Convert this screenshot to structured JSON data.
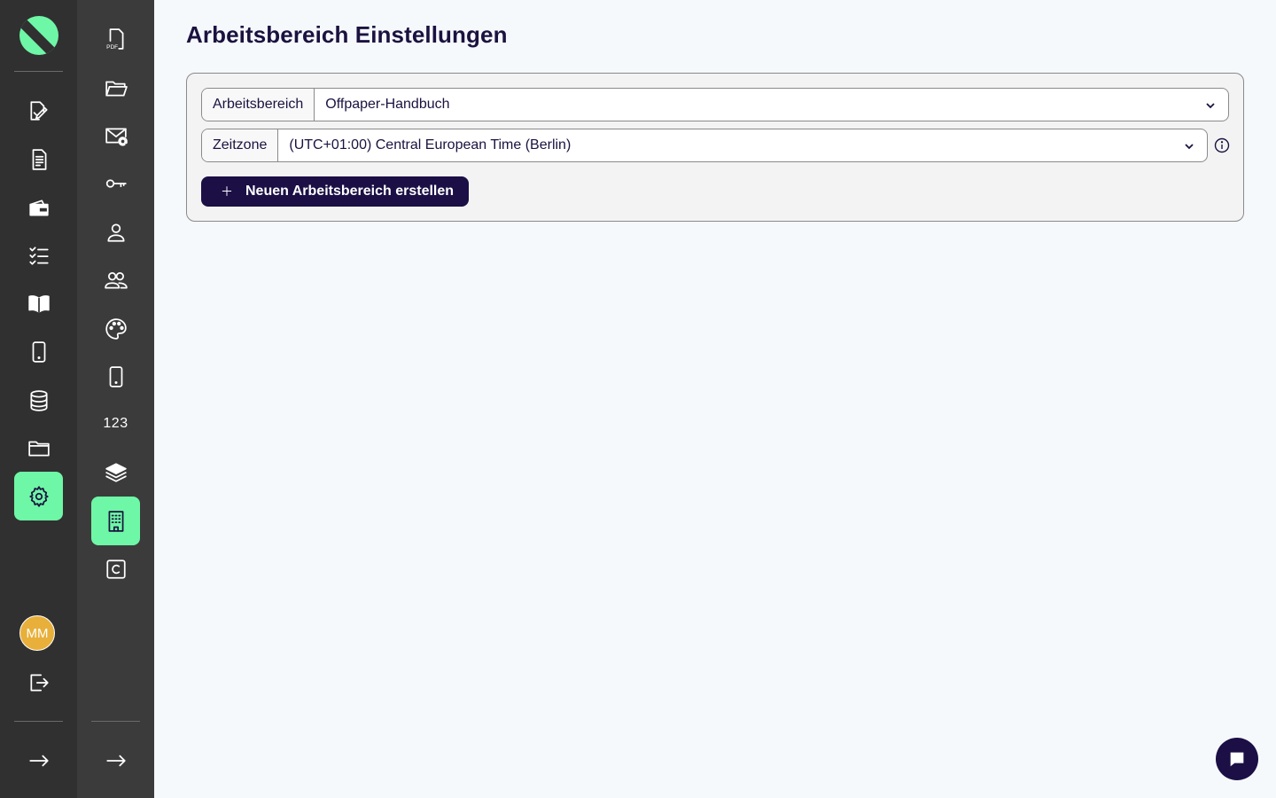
{
  "page": {
    "title": "Arbeitsbereich Einstellungen"
  },
  "workspace": {
    "label": "Arbeitsbereich",
    "value": "Offpaper-Handbuch"
  },
  "timezone": {
    "label": "Zeitzone",
    "value": "(UTC+01:00) Central European Time (Berlin)"
  },
  "create_button": {
    "label": "Neuen Arbeitsbereich erstellen"
  },
  "user": {
    "initials": "MM"
  },
  "rail2": {
    "numbers_label": "123"
  },
  "colors": {
    "accent": "#6ef7a6",
    "primary": "#1b0f45",
    "avatar": "#e8b03a",
    "rail_dark": "#303030",
    "rail_mid": "#3b3b3b"
  },
  "icons": {
    "rail1": [
      "logo-icon",
      "edit-document-icon",
      "document-icon",
      "wallet-icon",
      "checklist-icon",
      "book-icon",
      "phone-icon",
      "database-icon",
      "folder-icon",
      "settings-icon",
      "logout-icon",
      "arrow-right-icon"
    ],
    "rail2": [
      "pdf-icon",
      "folder-open-icon",
      "mail-at-icon",
      "key-icon",
      "user-icon",
      "users-icon",
      "palette-icon",
      "phone-icon",
      "numbers-icon",
      "layers-icon",
      "building-icon",
      "copyright-icon",
      "arrow-right-icon"
    ]
  }
}
